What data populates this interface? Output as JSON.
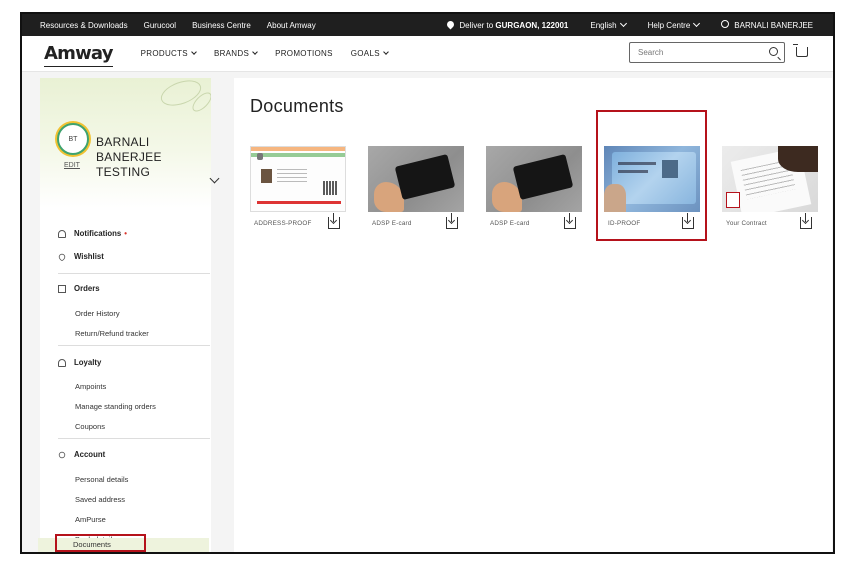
{
  "topbar": {
    "links": [
      "Resources & Downloads",
      "Gurucool",
      "Business Centre",
      "About Amway"
    ],
    "deliver_prefix": "Deliver to ",
    "deliver_city": "GURGAON, ",
    "deliver_pin": "122001",
    "language": "English",
    "help": "Help Centre",
    "user": "BARNALI BANERJEE"
  },
  "nav": {
    "logo": "Amway",
    "links": [
      "PRODUCTS",
      "BRANDS",
      "PROMOTIONS",
      "GOALS"
    ],
    "search_placeholder": "Search"
  },
  "profile": {
    "initials": "BT",
    "edit": "EDIT",
    "name": "BARNALI BANERJEE TESTING"
  },
  "sidebar": {
    "notifications": "Notifications",
    "notifications_dot": "•",
    "wishlist": "Wishlist",
    "orders": {
      "label": "Orders",
      "items": [
        "Order History",
        "Return/Refund tracker"
      ]
    },
    "loyalty": {
      "label": "Loyalty",
      "items": [
        "Ampoints",
        "Manage standing orders",
        "Coupons"
      ]
    },
    "account": {
      "label": "Account",
      "items": [
        "Personal details",
        "Saved address",
        "AmPurse",
        "Bank details",
        "Documents"
      ]
    }
  },
  "main": {
    "title": "Documents",
    "documents": [
      {
        "label": "ADDRESS-PROOF",
        "thumb": "aadhaar-card"
      },
      {
        "label": "ADSP E-card",
        "thumb": "black-card"
      },
      {
        "label": "ADSP E-card",
        "thumb": "black-card"
      },
      {
        "label": "ID-PROOF",
        "thumb": "pan-card"
      },
      {
        "label": "Your Contract",
        "thumb": "contract-signing"
      }
    ]
  },
  "colors": {
    "highlight": "#b5121b",
    "topbar": "#1f1f1f",
    "profile_band": "#e9f1d4"
  }
}
